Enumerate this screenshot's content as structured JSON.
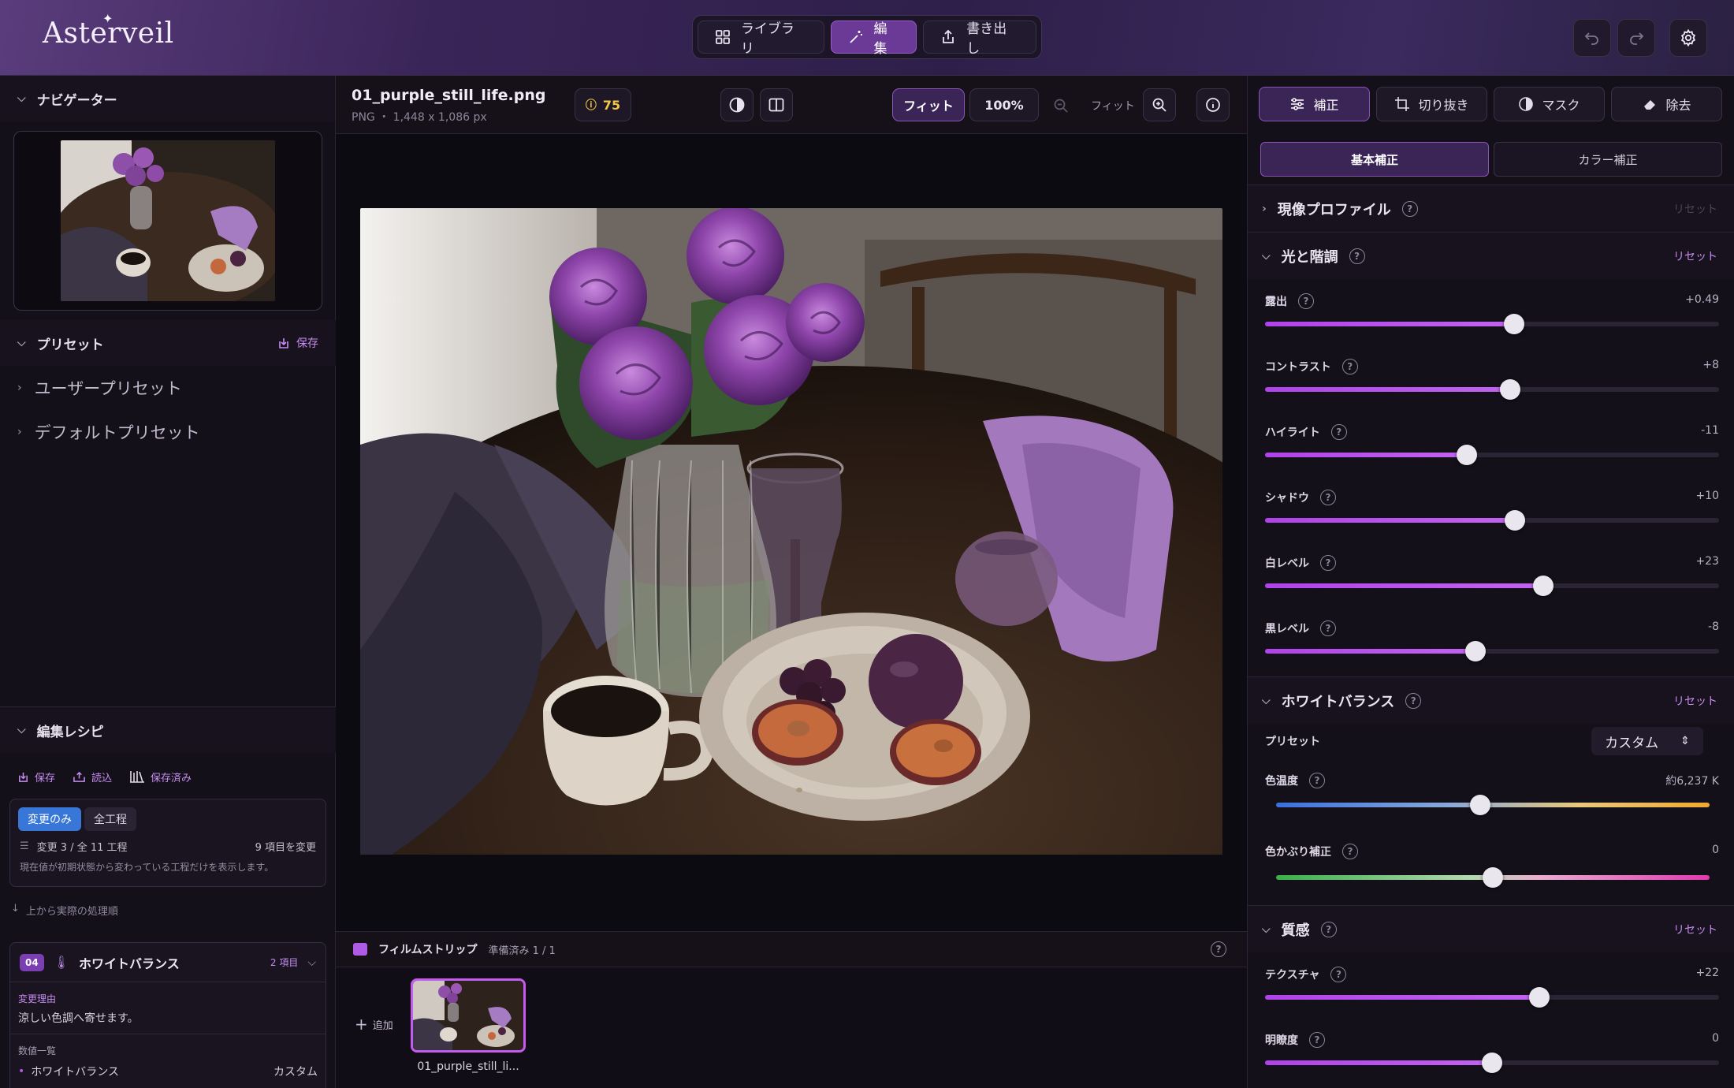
{
  "app": {
    "logo": "Asterveil"
  },
  "topnav": {
    "library": "ライブラリ",
    "edit": "編集",
    "export": "書き出し"
  },
  "left": {
    "navigator": "ナビゲーター",
    "presets": "プリセット",
    "preset_save": "保存",
    "user_presets": "ユーザープリセット",
    "default_presets": "デフォルトプリセット",
    "recipe": "編集レシピ",
    "recipe_save": "保存",
    "recipe_load": "読込",
    "recipe_saved": "保存済み",
    "tab_changed": "変更のみ",
    "tab_all": "全工程",
    "changes_count": "変更 3 / 全 11 工程",
    "changes_items": "9 項目を変更",
    "changes_desc": "現在値が初期状態から変わっている工程だけを表示します。",
    "order_note": "上から実際の処理順",
    "step_no": "04",
    "step_name": "ホワイトバランス",
    "step_items": "2 項目",
    "reason_label": "変更理由",
    "reason_text": "涼しい色調へ寄せます。",
    "values_label": "数値一覧",
    "value_name": "ホワイトバランス",
    "value_val": "カスタム"
  },
  "center": {
    "filename": "01_purple_still_life.png",
    "meta": "PNG ・ 1,448 x 1,086 px",
    "score": "75",
    "fit": "フィット",
    "zoom": "100%",
    "fit2": "フィット",
    "filmstrip": "フィルムストリップ",
    "film_status": "準備済み 1 / 1",
    "add": "追加",
    "thumb_name": "01_purple_still_li..."
  },
  "right": {
    "tabs": [
      "補正",
      "切り抜き",
      "マスク",
      "除去"
    ],
    "subtabs": [
      "基本補正",
      "カラー補正"
    ],
    "profile": "現像プロファイル",
    "reset": "リセット",
    "light": "光と階調",
    "sliders": [
      {
        "label": "露出",
        "value": "+0.49",
        "pos": 0.549
      },
      {
        "label": "コントラスト",
        "value": "+8",
        "pos": 0.54
      },
      {
        "label": "ハイライト",
        "value": "-11",
        "pos": 0.445
      },
      {
        "label": "シャドウ",
        "value": "+10",
        "pos": 0.55
      },
      {
        "label": "白レベル",
        "value": "+23",
        "pos": 0.612
      },
      {
        "label": "黒レベル",
        "value": "-8",
        "pos": 0.463
      }
    ],
    "wb": "ホワイトバランス",
    "wb_preset_label": "プリセット",
    "wb_preset_value": "カスタム",
    "temp_label": "色温度",
    "temp_value": "約6,237 K",
    "temp_pos": 0.47,
    "tint_label": "色かぶり補正",
    "tint_value": "0",
    "tint_pos": 0.5,
    "texture_group": "質感",
    "texture_sliders": [
      {
        "label": "テクスチャ",
        "value": "+22",
        "pos": 0.605
      },
      {
        "label": "明瞭度",
        "value": "0",
        "pos": 0.5
      }
    ]
  }
}
